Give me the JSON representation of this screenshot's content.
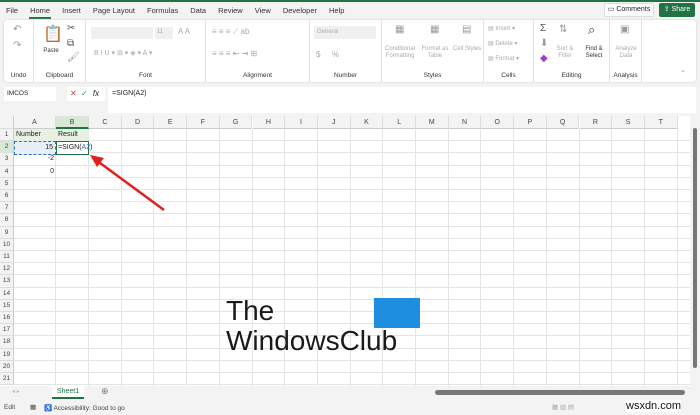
{
  "tabs": [
    "File",
    "Home",
    "Insert",
    "Page Layout",
    "Formulas",
    "Data",
    "Review",
    "View",
    "Developer",
    "Help"
  ],
  "active_tab": "Home",
  "header_buttons": {
    "comments": "Comments",
    "share": "Share"
  },
  "ribbon": {
    "groups": {
      "undo": "Undo",
      "clipboard": "Clipboard",
      "font": "Font",
      "alignment": "Alignment",
      "number": "Number",
      "styles": "Styles",
      "cells": "Cells",
      "editing": "Editing",
      "analysis": "Analysis"
    },
    "paste": "Paste",
    "font_size": "11",
    "number_format": "General",
    "currency": "$",
    "percent": "%",
    "conditional_formatting": "Conditional Formatting",
    "format_as_table": "Format as Table",
    "cell_styles": "Cell Styles",
    "insert": "Insert",
    "delete": "Delete",
    "format": "Format",
    "sort_filter": "Sort & Filter",
    "find_select": "Find & Select",
    "analyze_data": "Analyze Data"
  },
  "formula_bar": {
    "name_box": "IMCOS",
    "fx": "fx",
    "formula": "=SIGN(A2)"
  },
  "columns": [
    "A",
    "B",
    "C",
    "D",
    "E",
    "F",
    "G",
    "H",
    "I",
    "J",
    "K",
    "L",
    "M",
    "N",
    "O",
    "P",
    "Q",
    "R",
    "S",
    "T"
  ],
  "rows": [
    "1",
    "2",
    "3",
    "4",
    "5",
    "6",
    "7",
    "8",
    "9",
    "10",
    "11",
    "12",
    "13",
    "14",
    "15",
    "16",
    "17",
    "18",
    "19",
    "20",
    "21"
  ],
  "cells": {
    "A1": "Number",
    "B1": "Result",
    "A2": "15",
    "B2_prefix": "=SIGN(",
    "B2_ref": "A2",
    "B2_suffix": ")",
    "A3": "-2",
    "A4": "0"
  },
  "sheet_tabs": [
    "Sheet1"
  ],
  "status": {
    "mode": "Edit",
    "accessibility": "Accessibility: Good to go"
  },
  "watermark": {
    "line1": "The",
    "line2": "WindowsClub"
  },
  "site_mark": "wsxdn.com",
  "colors": {
    "accent": "#217346",
    "arrow": "#e02020",
    "ref": "#2f6fc0"
  }
}
